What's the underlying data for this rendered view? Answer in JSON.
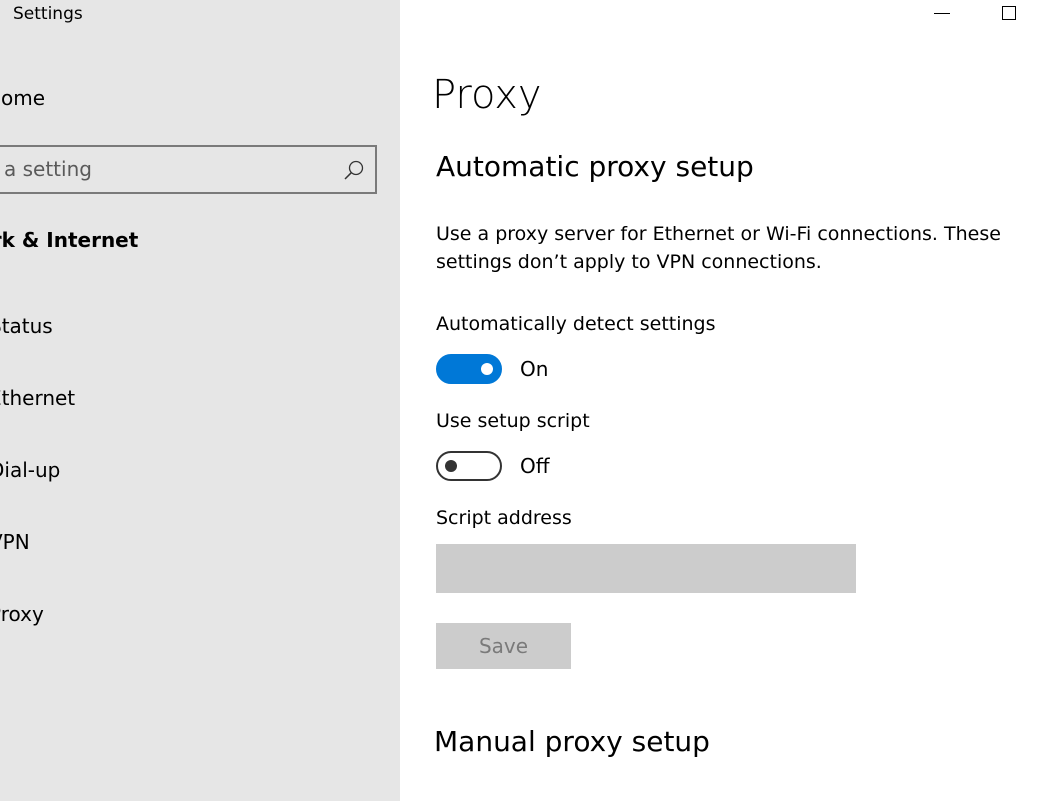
{
  "window": {
    "title": "Settings",
    "minimize_icon": "minimize-icon",
    "maximize_icon": "maximize-icon"
  },
  "sidebar": {
    "home_label": "Home",
    "search": {
      "placeholder": "a setting",
      "icon": "search-icon"
    },
    "section_heading": "ork & Internet",
    "items": [
      {
        "label": "Status"
      },
      {
        "label": "Ethernet"
      },
      {
        "label": "Dial-up"
      },
      {
        "label": "VPN"
      },
      {
        "label": "Proxy"
      }
    ]
  },
  "main": {
    "page_title": "Proxy",
    "automatic": {
      "heading": "Automatic proxy setup",
      "description": "Use a proxy server for Ethernet or Wi-Fi connections. These settings don’t apply to VPN connections.",
      "auto_detect": {
        "label": "Automatically detect settings",
        "state": "On",
        "enabled": true
      },
      "setup_script": {
        "label": "Use setup script",
        "state": "Off",
        "enabled": false
      },
      "script_address": {
        "label": "Script address",
        "value": ""
      },
      "save_label": "Save"
    },
    "manual": {
      "heading": "Manual proxy setup"
    }
  },
  "colors": {
    "accent": "#0078d7",
    "sidebar_bg": "#e6e6e6",
    "disabled_bg": "#cccccc"
  }
}
